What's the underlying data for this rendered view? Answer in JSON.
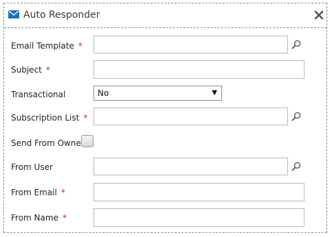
{
  "dialog": {
    "title": "Auto Responder",
    "title_icon": "envelope-icon",
    "close_icon": "close-icon"
  },
  "form": {
    "email_template": {
      "label": "Email Template",
      "required": "*",
      "value": "",
      "icon": "search-icon"
    },
    "subject": {
      "label": "Subject",
      "required": "*",
      "value": ""
    },
    "transactional": {
      "label": "Transactional",
      "selected": "No"
    },
    "subscription_list": {
      "label": "Subscription List",
      "required": "*",
      "value": "",
      "icon": "search-icon"
    },
    "send_from_owner": {
      "label": "Send From Owner",
      "checked": false
    },
    "from_user": {
      "label": "From User",
      "value": "",
      "icon": "search-icon"
    },
    "from_email": {
      "label": "From Email",
      "required": "*",
      "value": ""
    },
    "from_name": {
      "label": "From Name",
      "required": "*",
      "value": ""
    }
  },
  "colors": {
    "required": "#d11a1a",
    "icon_blue": "#1a73c9",
    "border": "#b7b7b7"
  }
}
